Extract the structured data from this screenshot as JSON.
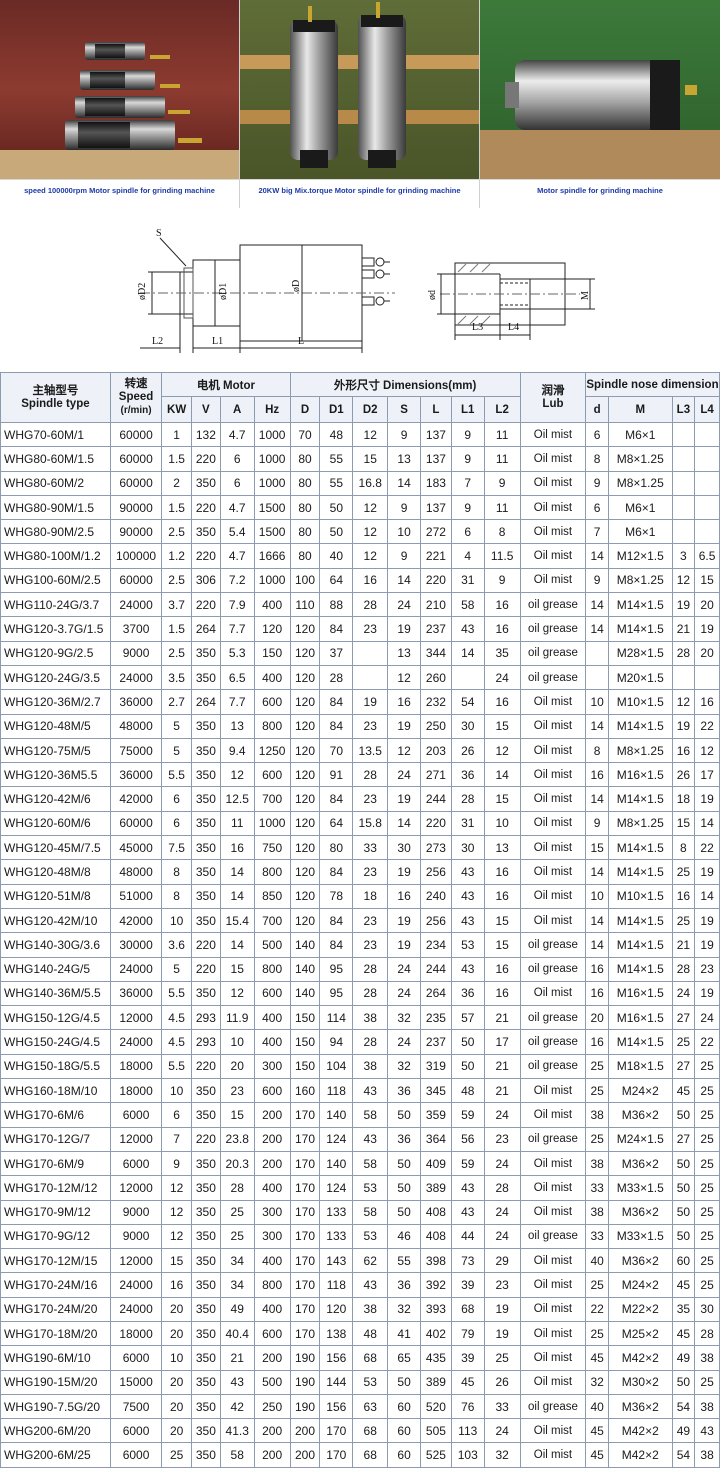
{
  "photos": [
    {
      "caption": "speed 100000rpm  Motor spindle for grinding  machine"
    },
    {
      "caption": "20KW big Mix.torque  Motor spindle for grinding  machine"
    },
    {
      "caption": "Motor spindle for grinding  machine"
    }
  ],
  "drawing": {
    "labels": {
      "S": "S",
      "D2": "øD2",
      "D1": "øD1",
      "D": "øD",
      "L2": "L2",
      "L1": "L1",
      "L": "L",
      "d": "ød",
      "M": "M",
      "L3": "L3",
      "L4": "L4"
    }
  },
  "table": {
    "head": {
      "model_cn": "主轴型号",
      "model_en": "Spindle type",
      "speed_cn": "转速",
      "speed_en": "Speed",
      "speed_unit": "(r/min)",
      "motor": "电机 Motor",
      "dims": "外形尺寸 Dimensions(mm)",
      "lub_cn": "润滑",
      "lub_en": "Lub",
      "nose": "Spindle nose dimensions",
      "cols": {
        "kw": "KW",
        "v": "V",
        "a": "A",
        "hz": "Hz",
        "D": "D",
        "D1": "D1",
        "D2": "D2",
        "S": "S",
        "L": "L",
        "L1": "L1",
        "L2": "L2",
        "d": "d",
        "M": "M",
        "L3": "L3",
        "L4": "L4"
      }
    },
    "rows": [
      [
        "WHG70-60M/1",
        "60000",
        "1",
        "132",
        "4.7",
        "1000",
        "70",
        "48",
        "12",
        "9",
        "137",
        "9",
        "11",
        "Oil mist",
        "6",
        "M6×1",
        "",
        ""
      ],
      [
        "WHG80-60M/1.5",
        "60000",
        "1.5",
        "220",
        "6",
        "1000",
        "80",
        "55",
        "15",
        "13",
        "137",
        "9",
        "11",
        "Oil mist",
        "8",
        "M8×1.25",
        "",
        ""
      ],
      [
        "WHG80-60M/2",
        "60000",
        "2",
        "350",
        "6",
        "1000",
        "80",
        "55",
        "16.8",
        "14",
        "183",
        "7",
        "9",
        "Oil mist",
        "9",
        "M8×1.25",
        "",
        ""
      ],
      [
        "WHG80-90M/1.5",
        "90000",
        "1.5",
        "220",
        "4.7",
        "1500",
        "80",
        "50",
        "12",
        "9",
        "137",
        "9",
        "11",
        "Oil mist",
        "6",
        "M6×1",
        "",
        ""
      ],
      [
        "WHG80-90M/2.5",
        "90000",
        "2.5",
        "350",
        "5.4",
        "1500",
        "80",
        "50",
        "12",
        "10",
        "272",
        "6",
        "8",
        "Oil mist",
        "7",
        "M6×1",
        "",
        ""
      ],
      [
        "WHG80-100M/1.2",
        "100000",
        "1.2",
        "220",
        "4.7",
        "1666",
        "80",
        "40",
        "12",
        "9",
        "221",
        "4",
        "11.5",
        "Oil mist",
        "14",
        "M12×1.5",
        "3",
        "6.5"
      ],
      [
        "WHG100-60M/2.5",
        "60000",
        "2.5",
        "306",
        "7.2",
        "1000",
        "100",
        "64",
        "16",
        "14",
        "220",
        "31",
        "9",
        "Oil mist",
        "9",
        "M8×1.25",
        "12",
        "15"
      ],
      [
        "WHG110-24G/3.7",
        "24000",
        "3.7",
        "220",
        "7.9",
        "400",
        "110",
        "88",
        "28",
        "24",
        "210",
        "58",
        "16",
        "oil grease",
        "14",
        "M14×1.5",
        "19",
        "20"
      ],
      [
        "WHG120-3.7G/1.5",
        "3700",
        "1.5",
        "264",
        "7.7",
        "120",
        "120",
        "84",
        "23",
        "19",
        "237",
        "43",
        "16",
        "oil grease",
        "14",
        "M14×1.5",
        "21",
        "19"
      ],
      [
        "WHG120-9G/2.5",
        "9000",
        "2.5",
        "350",
        "5.3",
        "150",
        "120",
        "37",
        "",
        "13",
        "344",
        "14",
        "35",
        "oil grease",
        "",
        "M28×1.5",
        "28",
        "20"
      ],
      [
        "WHG120-24G/3.5",
        "24000",
        "3.5",
        "350",
        "6.5",
        "400",
        "120",
        "28",
        "",
        "12",
        "260",
        "",
        "24",
        "oil grease",
        "",
        "M20×1.5",
        "",
        ""
      ],
      [
        "WHG120-36M/2.7",
        "36000",
        "2.7",
        "264",
        "7.7",
        "600",
        "120",
        "84",
        "19",
        "16",
        "232",
        "54",
        "16",
        "Oil mist",
        "10",
        "M10×1.5",
        "12",
        "16"
      ],
      [
        "WHG120-48M/5",
        "48000",
        "5",
        "350",
        "13",
        "800",
        "120",
        "84",
        "23",
        "19",
        "250",
        "30",
        "15",
        "Oil mist",
        "14",
        "M14×1.5",
        "19",
        "22"
      ],
      [
        "WHG120-75M/5",
        "75000",
        "5",
        "350",
        "9.4",
        "1250",
        "120",
        "70",
        "13.5",
        "12",
        "203",
        "26",
        "12",
        "Oil mist",
        "8",
        "M8×1.25",
        "16",
        "12"
      ],
      [
        "WHG120-36M5.5",
        "36000",
        "5.5",
        "350",
        "12",
        "600",
        "120",
        "91",
        "28",
        "24",
        "271",
        "36",
        "14",
        "Oil mist",
        "16",
        "M16×1.5",
        "26",
        "17"
      ],
      [
        "WHG120-42M/6",
        "42000",
        "6",
        "350",
        "12.5",
        "700",
        "120",
        "84",
        "23",
        "19",
        "244",
        "28",
        "15",
        "Oil mist",
        "14",
        "M14×1.5",
        "18",
        "19"
      ],
      [
        "WHG120-60M/6",
        "60000",
        "6",
        "350",
        "11",
        "1000",
        "120",
        "64",
        "15.8",
        "14",
        "220",
        "31",
        "10",
        "Oil mist",
        "9",
        "M8×1.25",
        "15",
        "14"
      ],
      [
        "WHG120-45M/7.5",
        "45000",
        "7.5",
        "350",
        "16",
        "750",
        "120",
        "80",
        "33",
        "30",
        "273",
        "30",
        "13",
        "Oil mist",
        "15",
        "M14×1.5",
        "8",
        "22"
      ],
      [
        "WHG120-48M/8",
        "48000",
        "8",
        "350",
        "14",
        "800",
        "120",
        "84",
        "23",
        "19",
        "256",
        "43",
        "16",
        "Oil mist",
        "14",
        "M14×1.5",
        "25",
        "19"
      ],
      [
        "WHG120-51M/8",
        "51000",
        "8",
        "350",
        "14",
        "850",
        "120",
        "78",
        "18",
        "16",
        "240",
        "43",
        "16",
        "Oil mist",
        "10",
        "M10×1.5",
        "16",
        "14"
      ],
      [
        "WHG120-42M/10",
        "42000",
        "10",
        "350",
        "15.4",
        "700",
        "120",
        "84",
        "23",
        "19",
        "256",
        "43",
        "15",
        "Oil mist",
        "14",
        "M14×1.5",
        "25",
        "19"
      ],
      [
        "WHG140-30G/3.6",
        "30000",
        "3.6",
        "220",
        "14",
        "500",
        "140",
        "84",
        "23",
        "19",
        "234",
        "53",
        "15",
        "oil grease",
        "14",
        "M14×1.5",
        "21",
        "19"
      ],
      [
        "WHG140-24G/5",
        "24000",
        "5",
        "220",
        "15",
        "800",
        "140",
        "95",
        "28",
        "24",
        "244",
        "43",
        "16",
        "oil grease",
        "16",
        "M14×1.5",
        "28",
        "23"
      ],
      [
        "WHG140-36M/5.5",
        "36000",
        "5.5",
        "350",
        "12",
        "600",
        "140",
        "95",
        "28",
        "24",
        "264",
        "36",
        "16",
        "Oil mist",
        "16",
        "M16×1.5",
        "24",
        "19"
      ],
      [
        "WHG150-12G/4.5",
        "12000",
        "4.5",
        "293",
        "11.9",
        "400",
        "150",
        "114",
        "38",
        "32",
        "235",
        "57",
        "21",
        "oil grease",
        "20",
        "M16×1.5",
        "27",
        "24"
      ],
      [
        "WHG150-24G/4.5",
        "24000",
        "4.5",
        "293",
        "10",
        "400",
        "150",
        "94",
        "28",
        "24",
        "237",
        "50",
        "17",
        "oil grease",
        "16",
        "M14×1.5",
        "25",
        "22"
      ],
      [
        "WHG150-18G/5.5",
        "18000",
        "5.5",
        "220",
        "20",
        "300",
        "150",
        "104",
        "38",
        "32",
        "319",
        "50",
        "21",
        "oil grease",
        "25",
        "M18×1.5",
        "27",
        "25"
      ],
      [
        "WHG160-18M/10",
        "18000",
        "10",
        "350",
        "23",
        "600",
        "160",
        "118",
        "43",
        "36",
        "345",
        "48",
        "21",
        "Oil mist",
        "25",
        "M24×2",
        "45",
        "25"
      ],
      [
        "WHG170-6M/6",
        "6000",
        "6",
        "350",
        "15",
        "200",
        "170",
        "140",
        "58",
        "50",
        "359",
        "59",
        "24",
        "Oil mist",
        "38",
        "M36×2",
        "50",
        "25"
      ],
      [
        "WHG170-12G/7",
        "12000",
        "7",
        "220",
        "23.8",
        "200",
        "170",
        "124",
        "43",
        "36",
        "364",
        "56",
        "23",
        "oil grease",
        "25",
        "M24×1.5",
        "27",
        "25"
      ],
      [
        "WHG170-6M/9",
        "6000",
        "9",
        "350",
        "20.3",
        "200",
        "170",
        "140",
        "58",
        "50",
        "409",
        "59",
        "24",
        "Oil mist",
        "38",
        "M36×2",
        "50",
        "25"
      ],
      [
        "WHG170-12M/12",
        "12000",
        "12",
        "350",
        "28",
        "400",
        "170",
        "124",
        "53",
        "50",
        "389",
        "43",
        "28",
        "Oil mist",
        "33",
        "M33×1.5",
        "50",
        "25"
      ],
      [
        "WHG170-9M/12",
        "9000",
        "12",
        "350",
        "25",
        "300",
        "170",
        "133",
        "58",
        "50",
        "408",
        "43",
        "24",
        "Oil mist",
        "38",
        "M36×2",
        "50",
        "25"
      ],
      [
        "WHG170-9G/12",
        "9000",
        "12",
        "350",
        "25",
        "300",
        "170",
        "133",
        "53",
        "46",
        "408",
        "44",
        "24",
        "oil grease",
        "33",
        "M33×1.5",
        "50",
        "25"
      ],
      [
        "WHG170-12M/15",
        "12000",
        "15",
        "350",
        "34",
        "400",
        "170",
        "143",
        "62",
        "55",
        "398",
        "73",
        "29",
        "Oil mist",
        "40",
        "M36×2",
        "60",
        "25"
      ],
      [
        "WHG170-24M/16",
        "24000",
        "16",
        "350",
        "34",
        "800",
        "170",
        "118",
        "43",
        "36",
        "392",
        "39",
        "23",
        "Oil mist",
        "25",
        "M24×2",
        "45",
        "25"
      ],
      [
        "WHG170-24M/20",
        "24000",
        "20",
        "350",
        "49",
        "400",
        "170",
        "120",
        "38",
        "32",
        "393",
        "68",
        "19",
        "Oil mist",
        "22",
        "M22×2",
        "35",
        "30"
      ],
      [
        "WHG170-18M/20",
        "18000",
        "20",
        "350",
        "40.4",
        "600",
        "170",
        "138",
        "48",
        "41",
        "402",
        "79",
        "19",
        "Oil mist",
        "25",
        "M25×2",
        "45",
        "28"
      ],
      [
        "WHG190-6M/10",
        "6000",
        "10",
        "350",
        "21",
        "200",
        "190",
        "156",
        "68",
        "65",
        "435",
        "39",
        "25",
        "Oil mist",
        "45",
        "M42×2",
        "49",
        "38"
      ],
      [
        "WHG190-15M/20",
        "15000",
        "20",
        "350",
        "43",
        "500",
        "190",
        "144",
        "53",
        "50",
        "389",
        "45",
        "26",
        "Oil mist",
        "32",
        "M30×2",
        "50",
        "25"
      ],
      [
        "WHG190-7.5G/20",
        "7500",
        "20",
        "350",
        "42",
        "250",
        "190",
        "156",
        "63",
        "60",
        "520",
        "76",
        "33",
        "oil grease",
        "40",
        "M36×2",
        "54",
        "38"
      ],
      [
        "WHG200-6M/20",
        "6000",
        "20",
        "350",
        "41.3",
        "200",
        "200",
        "170",
        "68",
        "60",
        "505",
        "113",
        "24",
        "Oil mist",
        "45",
        "M42×2",
        "49",
        "43"
      ],
      [
        "WHG200-6M/25",
        "6000",
        "25",
        "350",
        "58",
        "200",
        "200",
        "170",
        "68",
        "60",
        "525",
        "103",
        "32",
        "Oil mist",
        "45",
        "M42×2",
        "54",
        "38"
      ]
    ]
  }
}
